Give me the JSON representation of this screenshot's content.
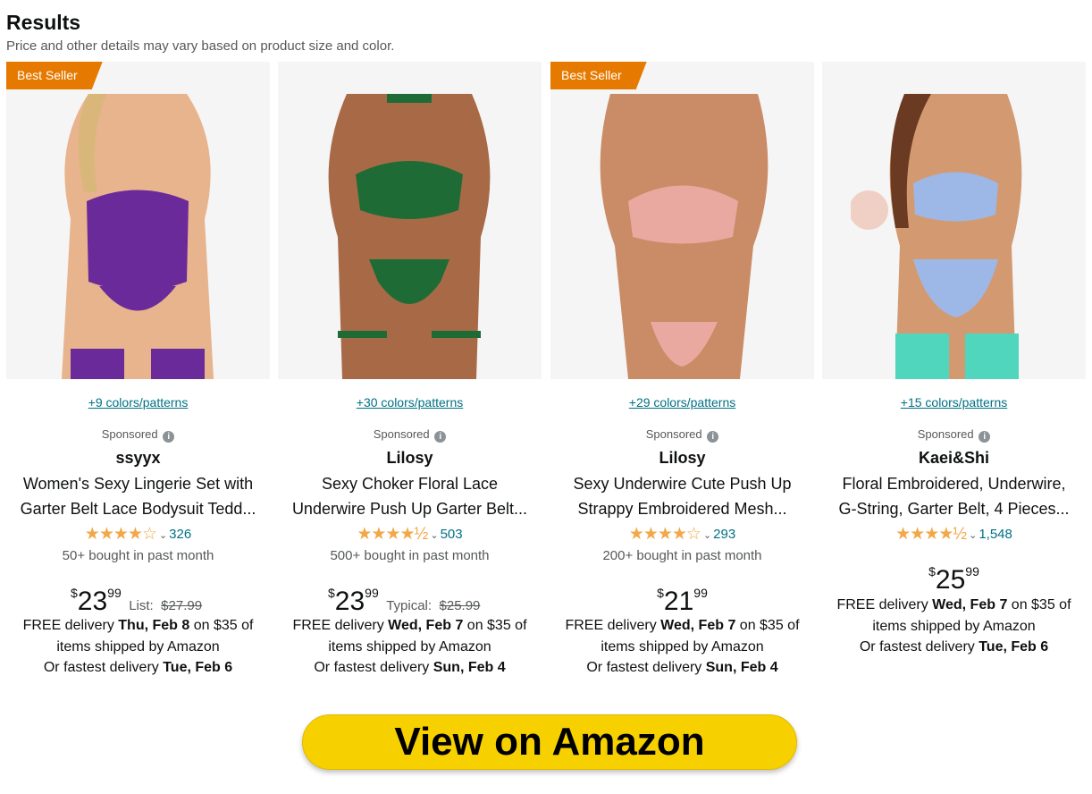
{
  "header": {
    "title": "Results",
    "subtitle": "Price and other details may vary based on product size and color."
  },
  "products": [
    {
      "badge": "Best Seller",
      "colors": "+9 colors/patterns",
      "sponsored": "Sponsored",
      "brand": "ssyyx",
      "title_line1": "Women's Sexy Lingerie Set with",
      "title_line2": "Garter Belt Lace Bodysuit Tedd...",
      "stars": "★★★★☆",
      "rating": 4.3,
      "rating_count": "326",
      "bought": "50+ bought in past month",
      "price_currency": "$",
      "price_whole": "23",
      "price_fraction": "99",
      "list_label": "List:",
      "list_price": "$27.99",
      "delivery_pre": "FREE delivery ",
      "delivery_date": "Thu, Feb 8",
      "delivery_post": " on $35 of items shipped by Amazon",
      "fastest_pre": "Or fastest delivery ",
      "fastest_date": "Tue, Feb 6",
      "color": "#6a2a9a",
      "skin": "#e8b48e"
    },
    {
      "badge": "",
      "colors": "+30 colors/patterns",
      "sponsored": "Sponsored",
      "brand": "Lilosy",
      "title_line1": "Sexy Choker Floral Lace",
      "title_line2": "Underwire Push Up Garter Belt...",
      "stars": "★★★★½",
      "rating": 4.5,
      "rating_count": "503",
      "bought": "500+ bought in past month",
      "price_currency": "$",
      "price_whole": "23",
      "price_fraction": "99",
      "list_label": "Typical:",
      "list_price": "$25.99",
      "delivery_pre": "FREE delivery ",
      "delivery_date": "Wed, Feb 7",
      "delivery_post": " on $35 of items shipped by Amazon",
      "fastest_pre": "Or fastest delivery ",
      "fastest_date": "Sun, Feb 4",
      "color": "#1e6b36",
      "skin": "#a86a46"
    },
    {
      "badge": "Best Seller",
      "colors": "+29 colors/patterns",
      "sponsored": "Sponsored",
      "brand": "Lilosy",
      "title_line1": "Sexy Underwire Cute Push Up",
      "title_line2": "Strappy Embroidered Mesh...",
      "stars": "★★★★☆",
      "rating": 4.1,
      "rating_count": "293",
      "bought": "200+ bought in past month",
      "price_currency": "$",
      "price_whole": "21",
      "price_fraction": "99",
      "list_label": "",
      "list_price": "",
      "delivery_pre": "FREE delivery ",
      "delivery_date": "Wed, Feb 7",
      "delivery_post": " on $35 of items shipped by Amazon",
      "fastest_pre": "Or fastest delivery ",
      "fastest_date": "Sun, Feb 4",
      "color": "#e9a9a0",
      "skin": "#c98c66"
    },
    {
      "badge": "",
      "colors": "+15 colors/patterns",
      "sponsored": "Sponsored",
      "brand": "Kaei&Shi",
      "title_line1": "Floral Embroidered, Underwire,",
      "title_line2": "G-String, Garter Belt, 4 Pieces...",
      "stars": "★★★★½",
      "rating": 4.5,
      "rating_count": "1,548",
      "bought": "",
      "price_currency": "$",
      "price_whole": "25",
      "price_fraction": "99",
      "list_label": "",
      "list_price": "",
      "delivery_pre": "FREE delivery ",
      "delivery_date": "Wed, Feb 7",
      "delivery_post": " on $35 of items shipped by Amazon",
      "fastest_pre": "Or fastest delivery ",
      "fastest_date": "Tue, Feb 6",
      "color": "#4fd6bd",
      "skin": "#d39a72"
    }
  ],
  "cta": {
    "label": "View on Amazon",
    "color": "#f7d000"
  },
  "theme": {
    "link": "#007185",
    "badge": "#e67a00",
    "star": "#f3a847"
  }
}
